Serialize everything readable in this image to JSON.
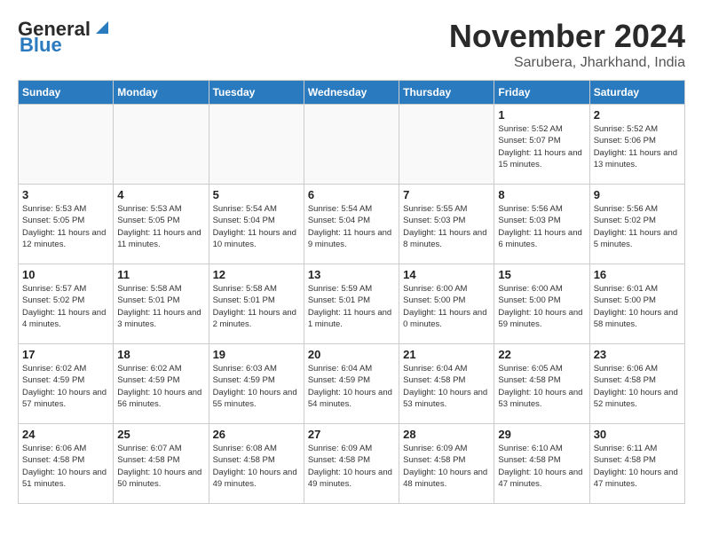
{
  "header": {
    "logo_line1": "General",
    "logo_line2": "Blue",
    "month_title": "November 2024",
    "location": "Sarubera, Jharkhand, India"
  },
  "weekdays": [
    "Sunday",
    "Monday",
    "Tuesday",
    "Wednesday",
    "Thursday",
    "Friday",
    "Saturday"
  ],
  "weeks": [
    [
      {
        "day": "",
        "info": ""
      },
      {
        "day": "",
        "info": ""
      },
      {
        "day": "",
        "info": ""
      },
      {
        "day": "",
        "info": ""
      },
      {
        "day": "",
        "info": ""
      },
      {
        "day": "1",
        "info": "Sunrise: 5:52 AM\nSunset: 5:07 PM\nDaylight: 11 hours and 15 minutes."
      },
      {
        "day": "2",
        "info": "Sunrise: 5:52 AM\nSunset: 5:06 PM\nDaylight: 11 hours and 13 minutes."
      }
    ],
    [
      {
        "day": "3",
        "info": "Sunrise: 5:53 AM\nSunset: 5:05 PM\nDaylight: 11 hours and 12 minutes."
      },
      {
        "day": "4",
        "info": "Sunrise: 5:53 AM\nSunset: 5:05 PM\nDaylight: 11 hours and 11 minutes."
      },
      {
        "day": "5",
        "info": "Sunrise: 5:54 AM\nSunset: 5:04 PM\nDaylight: 11 hours and 10 minutes."
      },
      {
        "day": "6",
        "info": "Sunrise: 5:54 AM\nSunset: 5:04 PM\nDaylight: 11 hours and 9 minutes."
      },
      {
        "day": "7",
        "info": "Sunrise: 5:55 AM\nSunset: 5:03 PM\nDaylight: 11 hours and 8 minutes."
      },
      {
        "day": "8",
        "info": "Sunrise: 5:56 AM\nSunset: 5:03 PM\nDaylight: 11 hours and 6 minutes."
      },
      {
        "day": "9",
        "info": "Sunrise: 5:56 AM\nSunset: 5:02 PM\nDaylight: 11 hours and 5 minutes."
      }
    ],
    [
      {
        "day": "10",
        "info": "Sunrise: 5:57 AM\nSunset: 5:02 PM\nDaylight: 11 hours and 4 minutes."
      },
      {
        "day": "11",
        "info": "Sunrise: 5:58 AM\nSunset: 5:01 PM\nDaylight: 11 hours and 3 minutes."
      },
      {
        "day": "12",
        "info": "Sunrise: 5:58 AM\nSunset: 5:01 PM\nDaylight: 11 hours and 2 minutes."
      },
      {
        "day": "13",
        "info": "Sunrise: 5:59 AM\nSunset: 5:01 PM\nDaylight: 11 hours and 1 minute."
      },
      {
        "day": "14",
        "info": "Sunrise: 6:00 AM\nSunset: 5:00 PM\nDaylight: 11 hours and 0 minutes."
      },
      {
        "day": "15",
        "info": "Sunrise: 6:00 AM\nSunset: 5:00 PM\nDaylight: 10 hours and 59 minutes."
      },
      {
        "day": "16",
        "info": "Sunrise: 6:01 AM\nSunset: 5:00 PM\nDaylight: 10 hours and 58 minutes."
      }
    ],
    [
      {
        "day": "17",
        "info": "Sunrise: 6:02 AM\nSunset: 4:59 PM\nDaylight: 10 hours and 57 minutes."
      },
      {
        "day": "18",
        "info": "Sunrise: 6:02 AM\nSunset: 4:59 PM\nDaylight: 10 hours and 56 minutes."
      },
      {
        "day": "19",
        "info": "Sunrise: 6:03 AM\nSunset: 4:59 PM\nDaylight: 10 hours and 55 minutes."
      },
      {
        "day": "20",
        "info": "Sunrise: 6:04 AM\nSunset: 4:59 PM\nDaylight: 10 hours and 54 minutes."
      },
      {
        "day": "21",
        "info": "Sunrise: 6:04 AM\nSunset: 4:58 PM\nDaylight: 10 hours and 53 minutes."
      },
      {
        "day": "22",
        "info": "Sunrise: 6:05 AM\nSunset: 4:58 PM\nDaylight: 10 hours and 53 minutes."
      },
      {
        "day": "23",
        "info": "Sunrise: 6:06 AM\nSunset: 4:58 PM\nDaylight: 10 hours and 52 minutes."
      }
    ],
    [
      {
        "day": "24",
        "info": "Sunrise: 6:06 AM\nSunset: 4:58 PM\nDaylight: 10 hours and 51 minutes."
      },
      {
        "day": "25",
        "info": "Sunrise: 6:07 AM\nSunset: 4:58 PM\nDaylight: 10 hours and 50 minutes."
      },
      {
        "day": "26",
        "info": "Sunrise: 6:08 AM\nSunset: 4:58 PM\nDaylight: 10 hours and 49 minutes."
      },
      {
        "day": "27",
        "info": "Sunrise: 6:09 AM\nSunset: 4:58 PM\nDaylight: 10 hours and 49 minutes."
      },
      {
        "day": "28",
        "info": "Sunrise: 6:09 AM\nSunset: 4:58 PM\nDaylight: 10 hours and 48 minutes."
      },
      {
        "day": "29",
        "info": "Sunrise: 6:10 AM\nSunset: 4:58 PM\nDaylight: 10 hours and 47 minutes."
      },
      {
        "day": "30",
        "info": "Sunrise: 6:11 AM\nSunset: 4:58 PM\nDaylight: 10 hours and 47 minutes."
      }
    ]
  ]
}
